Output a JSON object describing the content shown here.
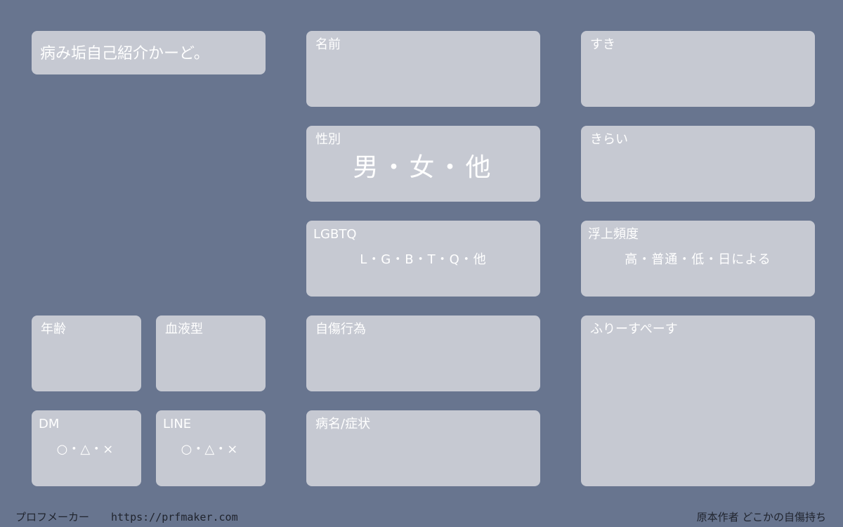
{
  "card_title": "病み垢自己紹介かーど。",
  "fields": {
    "name": {
      "label": "名前"
    },
    "like": {
      "label": "すき"
    },
    "gender": {
      "label": "性別",
      "options": "男・女・他"
    },
    "dislike": {
      "label": "きらい"
    },
    "lgbtq": {
      "label": "LGBTQ",
      "options": "L・G・B・T・Q・他"
    },
    "frequency": {
      "label": "浮上頻度",
      "options": "高・普通・低・日による"
    },
    "age": {
      "label": "年齢"
    },
    "blood_type": {
      "label": "血液型"
    },
    "self_harm": {
      "label": "自傷行為"
    },
    "free_space": {
      "label": "ふりーすぺーす"
    },
    "dm": {
      "label": "DM",
      "options": "○・△・×"
    },
    "line": {
      "label": "LINE",
      "options": "○・△・×"
    },
    "diagnosis": {
      "label": "病名/症状"
    }
  },
  "footer": {
    "maker_name": "プロフメーカー",
    "maker_url": "https://prfmaker.com",
    "credit": "原本作者 どこかの自傷持ち"
  },
  "colors": {
    "background": "#68758f",
    "card": "#c6c9d2",
    "text": "#ffffff",
    "footer_text": "#20242e"
  }
}
